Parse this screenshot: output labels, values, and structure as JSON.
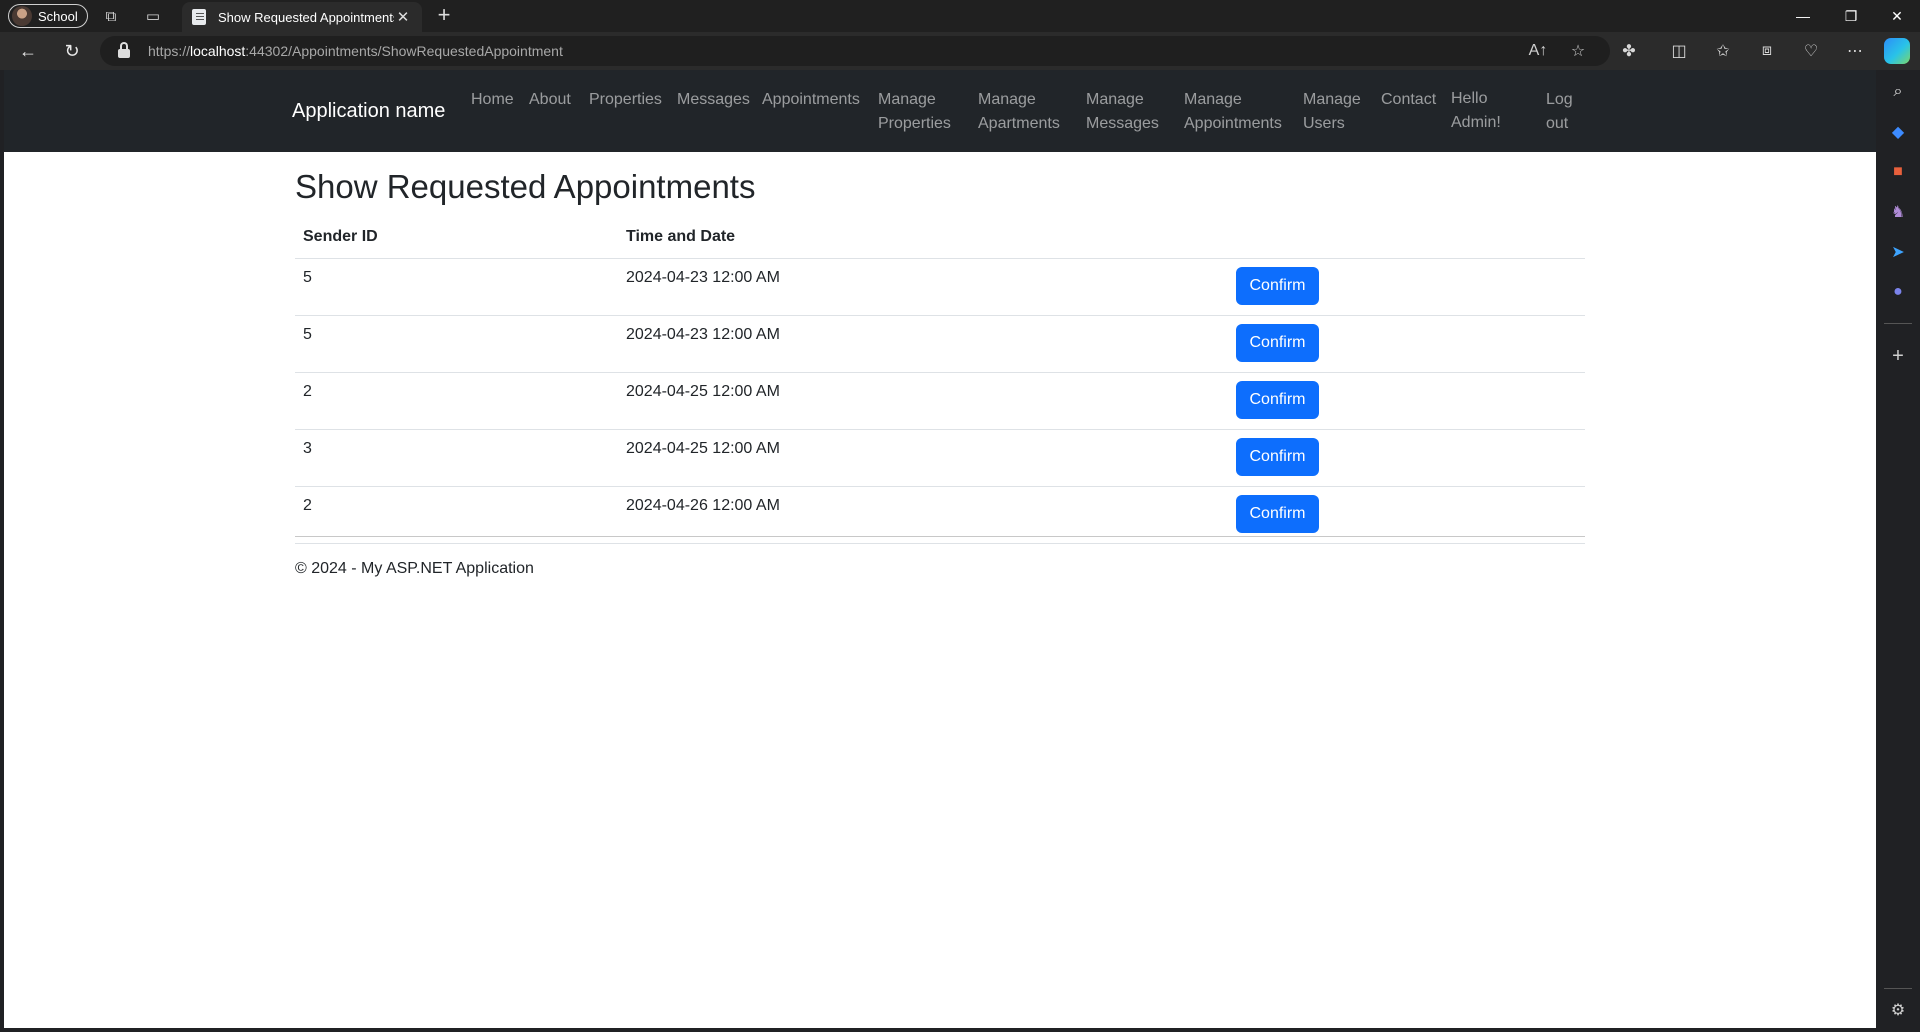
{
  "browser": {
    "profile_name": "School",
    "tab_title": "Show Requested Appointments",
    "tab_close": "✕",
    "new_tab": "+",
    "url_scheme": "https://",
    "url_host": "localhost",
    "url_rest": ":44302/Appointments/ShowRequestedAppointment",
    "window_controls": {
      "minimize": "—",
      "restore": "❐",
      "close": "✕"
    }
  },
  "app": {
    "brand": "Application name",
    "nav": [
      {
        "label": "Home"
      },
      {
        "label": "About"
      },
      {
        "label": "Properties"
      },
      {
        "label": "Messages"
      },
      {
        "label": "Appointments"
      },
      {
        "label": "Manage",
        "label2": "Properties"
      },
      {
        "label": "Manage",
        "label2": "Apartments"
      },
      {
        "label": "Manage",
        "label2": "Messages"
      },
      {
        "label": "Manage",
        "label2": "Appointments"
      },
      {
        "label": "Manage",
        "label2": "Users"
      },
      {
        "label": "Contact"
      },
      {
        "label": "Hello",
        "label2": "Admin!"
      },
      {
        "label": "Log",
        "label2": "out"
      }
    ]
  },
  "page": {
    "title": "Show Requested Appointments",
    "table": {
      "headers": [
        "Sender ID",
        "Time and Date",
        ""
      ],
      "rows": [
        {
          "sender_id": "5",
          "datetime": "2024-04-23 12:00 AM",
          "action": "Confirm"
        },
        {
          "sender_id": "5",
          "datetime": "2024-04-23 12:00 AM",
          "action": "Confirm"
        },
        {
          "sender_id": "2",
          "datetime": "2024-04-25 12:00 AM",
          "action": "Confirm"
        },
        {
          "sender_id": "3",
          "datetime": "2024-04-25 12:00 AM",
          "action": "Confirm"
        },
        {
          "sender_id": "2",
          "datetime": "2024-04-26 12:00 AM",
          "action": "Confirm"
        }
      ]
    },
    "footer": "© 2024 - My ASP.NET Application"
  },
  "colors": {
    "navbar": "#212529",
    "primary_button": "#0d6efd",
    "browser_chrome": "#202020"
  }
}
